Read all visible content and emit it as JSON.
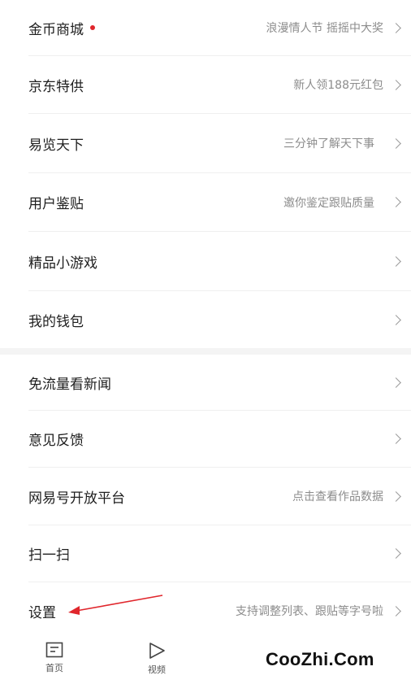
{
  "menu": {
    "items": [
      {
        "label": "金币商城",
        "sub": "浪漫情人节 摇摇中大奖",
        "dot": true
      },
      {
        "label": "京东特供",
        "sub": "新人领188元红包"
      },
      {
        "label": "易览天下",
        "sub": "三分钟了解天下事"
      },
      {
        "label": "用户鉴贴",
        "sub": "邀你鉴定跟贴质量"
      },
      {
        "label": "精品小游戏",
        "sub": ""
      },
      {
        "label": "我的钱包",
        "sub": ""
      },
      {
        "label": "免流量看新闻",
        "sub": ""
      },
      {
        "label": "意见反馈",
        "sub": ""
      },
      {
        "label": "网易号开放平台",
        "sub": "点击查看作品数据"
      },
      {
        "label": "扫一扫",
        "sub": ""
      },
      {
        "label": "设置",
        "sub": "支持调整列表、跟贴等字号啦"
      }
    ]
  },
  "tabbar": {
    "tabs": [
      {
        "label": "首页",
        "icon": "home-doc-icon"
      },
      {
        "label": "视频",
        "icon": "play-icon"
      }
    ]
  },
  "watermark": "CooZhi.Com",
  "colors": {
    "accent_red": "#e0262c",
    "arrow_red": "#e0262c",
    "sub_text": "#8c8c8c"
  }
}
